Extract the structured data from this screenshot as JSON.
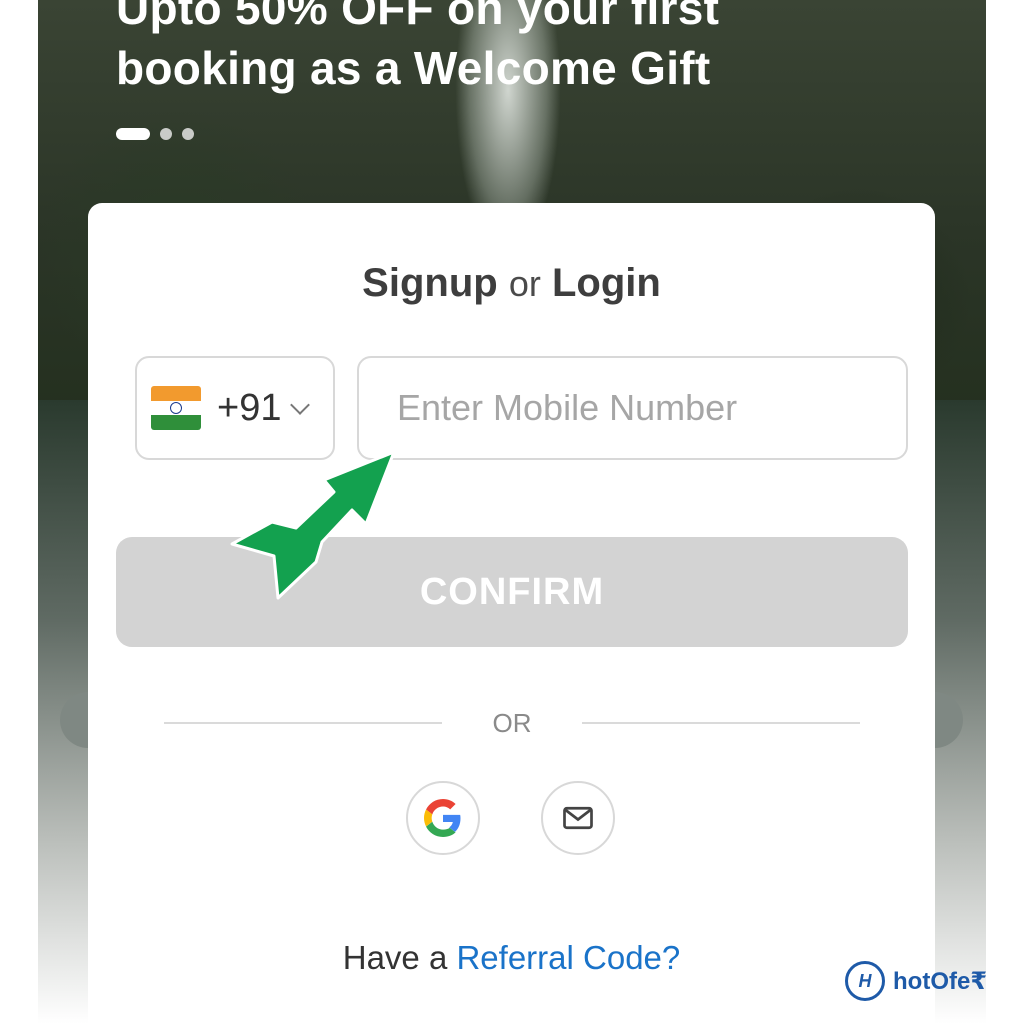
{
  "promo": {
    "line1": "Upto 50% OFF on your first",
    "line2": "booking as a Welcome Gift"
  },
  "carousel": {
    "total": 3,
    "active": 1
  },
  "auth": {
    "title_signup": "Signup",
    "title_or": "or",
    "title_login": "Login",
    "country_code": "+91",
    "country_flag": "india-flag-icon",
    "mobile_placeholder": "Enter Mobile Number",
    "mobile_value": "",
    "confirm_label": "CONFIRM",
    "divider_label": "OR",
    "social": [
      "google-icon",
      "email-icon"
    ],
    "referral_prefix": "Have a",
    "referral_link": "Referral Code?"
  },
  "watermark": {
    "brand": "hotOfe₹"
  },
  "colors": {
    "confirm_disabled": "#d3d3d3",
    "link": "#1a73c9",
    "annotation_arrow": "#13a14f",
    "brand": "#1e5aa8"
  }
}
